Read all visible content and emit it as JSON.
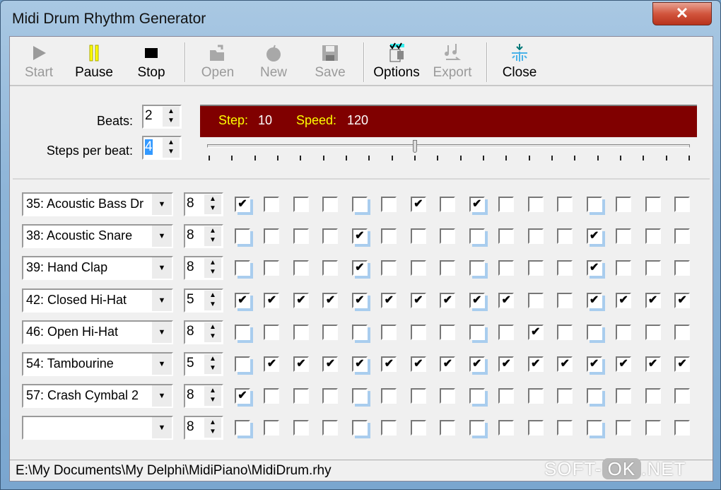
{
  "window": {
    "title": "Midi Drum Rhythm Generator",
    "close_glyph": "✕"
  },
  "toolbar": [
    {
      "id": "start",
      "label": "Start",
      "icon": "play-icon",
      "enabled": false
    },
    {
      "id": "pause",
      "label": "Pause",
      "icon": "pause-icon",
      "enabled": true
    },
    {
      "id": "stop",
      "label": "Stop",
      "icon": "stop-icon",
      "enabled": true
    },
    {
      "id": "open",
      "label": "Open",
      "icon": "open-folder-icon",
      "enabled": false
    },
    {
      "id": "new",
      "label": "New",
      "icon": "new-icon",
      "enabled": false
    },
    {
      "id": "save",
      "label": "Save",
      "icon": "floppy-icon",
      "enabled": false
    },
    {
      "id": "options",
      "label": "Options",
      "icon": "options-checklist-icon",
      "enabled": true
    },
    {
      "id": "export",
      "label": "Export",
      "icon": "export-music-icon",
      "enabled": false
    },
    {
      "id": "close",
      "label": "Close",
      "icon": "close-snowflake-icon",
      "enabled": true
    }
  ],
  "settings": {
    "beats_label": "Beats:",
    "beats": "2",
    "steps_label": "Steps per beat:",
    "steps": "4"
  },
  "display": {
    "step_label": "Step:",
    "step": "10",
    "speed_label": "Speed:",
    "speed": "120",
    "colors": {
      "bg": "#800000",
      "label": "#ffff00",
      "value": "#ffffff"
    }
  },
  "slider": {
    "ticks": 22,
    "position_fraction": 0.43
  },
  "rows": [
    {
      "instrument": "35: Acoustic Bass Dr",
      "velocity": "8",
      "steps": [
        1,
        0,
        0,
        0,
        0,
        0,
        1,
        0,
        1,
        0,
        0,
        0,
        0,
        0,
        0,
        0
      ]
    },
    {
      "instrument": "38: Acoustic Snare",
      "velocity": "8",
      "steps": [
        0,
        0,
        0,
        0,
        1,
        0,
        0,
        0,
        0,
        0,
        0,
        0,
        1,
        0,
        0,
        0
      ]
    },
    {
      "instrument": "39: Hand Clap",
      "velocity": "8",
      "steps": [
        0,
        0,
        0,
        0,
        1,
        0,
        0,
        0,
        0,
        0,
        0,
        0,
        1,
        0,
        0,
        0
      ]
    },
    {
      "instrument": "42: Closed Hi-Hat",
      "velocity": "5",
      "steps": [
        1,
        1,
        1,
        1,
        1,
        1,
        1,
        1,
        1,
        1,
        0,
        0,
        1,
        1,
        1,
        1
      ]
    },
    {
      "instrument": "46: Open Hi-Hat",
      "velocity": "8",
      "steps": [
        0,
        0,
        0,
        0,
        0,
        0,
        0,
        0,
        0,
        0,
        1,
        0,
        0,
        0,
        0,
        0
      ]
    },
    {
      "instrument": "54: Tambourine",
      "velocity": "5",
      "steps": [
        0,
        1,
        1,
        1,
        1,
        1,
        1,
        1,
        1,
        1,
        1,
        1,
        1,
        1,
        1,
        1
      ]
    },
    {
      "instrument": "57: Crash Cymbal 2",
      "velocity": "8",
      "steps": [
        1,
        0,
        0,
        0,
        0,
        0,
        0,
        0,
        0,
        0,
        0,
        0,
        0,
        0,
        0,
        0
      ]
    },
    {
      "instrument": "",
      "velocity": "8",
      "steps": [
        0,
        0,
        0,
        0,
        0,
        0,
        0,
        0,
        0,
        0,
        0,
        0,
        0,
        0,
        0,
        0
      ]
    }
  ],
  "status": {
    "path": "E:\\My Documents\\My Delphi\\MidiPiano\\MidiDrum.rhy"
  },
  "watermark": {
    "a": "SOFT-",
    "b": "OK",
    ".c": ".NET",
    "c": ".NET"
  }
}
